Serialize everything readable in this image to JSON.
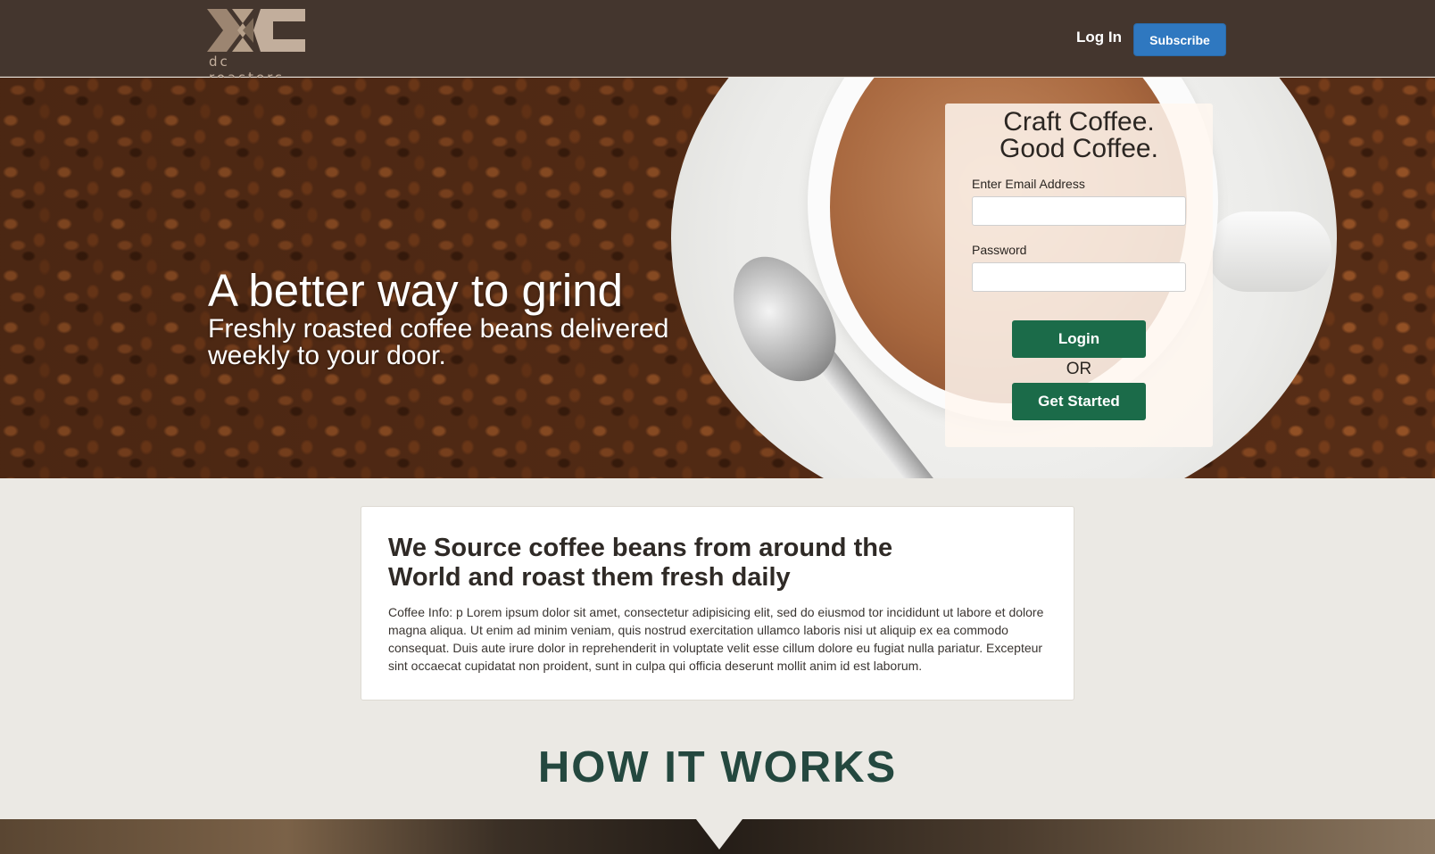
{
  "nav": {
    "logo_text": "dc roasters",
    "login_label": "Log In",
    "subscribe_label": "Subscribe"
  },
  "hero": {
    "headline": "A better way to grind",
    "subheadline": "Freshly roasted coffee beans delivered weekly to your door."
  },
  "login_form": {
    "title_line1": "Craft Coffee.",
    "title_line2": "Good Coffee.",
    "email_label": "Enter Email Address",
    "email_value": "",
    "password_label": "Password",
    "password_value": "",
    "login_button": "Login",
    "or_text": "OR",
    "get_started_button": "Get Started"
  },
  "info": {
    "title": "We Source coffee beans from around the World and roast them fresh daily",
    "body": "Coffee Info: p Lorem ipsum dolor sit amet, consectetur adipisicing elit, sed do eiusmod tor incididunt ut labore et dolore magna aliqua. Ut enim ad minim veniam, quis nostrud exercitation ullamco laboris nisi ut aliquip ex ea commodo consequat. Duis aute irure dolor in reprehenderit in voluptate velit esse cillum dolore eu fugiat nulla pariatur. Excepteur sint occaecat cupidatat non proident, sunt in culpa qui officia deserunt mollit anim id est laborum."
  },
  "how_it_works": {
    "title": "HOW IT WORKS"
  },
  "colors": {
    "navbar_bg": "#44362e",
    "subscribe_blue": "#2f78c0",
    "action_green": "#1b6b49",
    "heading_green": "#24483f",
    "page_bg": "#ebe9e4"
  }
}
